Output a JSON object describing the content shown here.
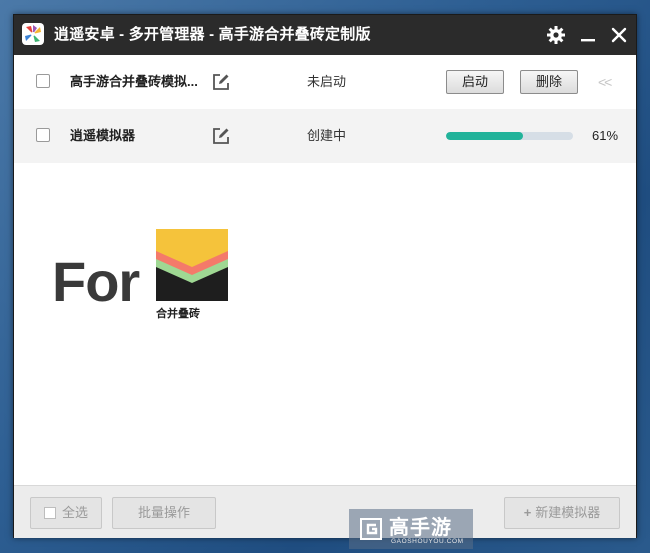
{
  "window": {
    "title": "逍遥安卓 - 多开管理器 - 高手游合并叠砖定制版"
  },
  "titlebar": {
    "icons": [
      "app-logo-icon",
      "gear-icon",
      "minimize-icon",
      "close-icon"
    ]
  },
  "instances": [
    {
      "name": "高手游合并叠砖模拟...",
      "status": "未启动",
      "start_label": "启动",
      "delete_label": "删除",
      "more_label": "<<"
    },
    {
      "name": "逍遥模拟器",
      "status": "创建中",
      "progress": 61,
      "progress_label": "61%"
    }
  ],
  "promo": {
    "for_text": "For",
    "game_name": "合并叠砖"
  },
  "footer": {
    "select_all_label": "全选",
    "batch_label": "批量操作",
    "new_label": "新建模拟器"
  },
  "watermark": {
    "brand": "高手游",
    "domain": "GAOSHOUYOU.COM"
  },
  "colors": {
    "titlebar": "#2b2b2b",
    "progress": "#21b39a",
    "game_yellow": "#f5c33b",
    "game_coral": "#f47a6a",
    "game_green": "#9fd893",
    "game_dark": "#1e1e1e"
  }
}
